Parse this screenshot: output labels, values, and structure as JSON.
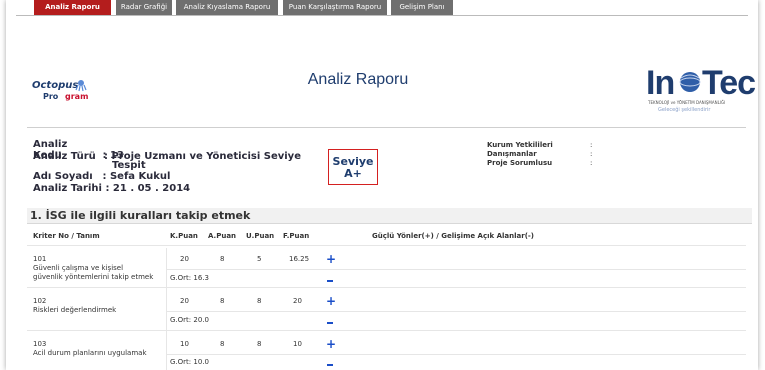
{
  "tabs": [
    {
      "label": "Analiz Raporu",
      "active": true
    },
    {
      "label": "Radar Grafiği",
      "active": false
    },
    {
      "label": "Analiz Kıyaslama Raporu",
      "active": false
    },
    {
      "label": "Puan Karşılaştırma Raporu",
      "active": false
    },
    {
      "label": "Gelişim Planı",
      "active": false
    }
  ],
  "logos": {
    "left_line1": "Octopus",
    "left_line2_a": "Pro",
    "left_line2_b": "gram",
    "right_in": "In",
    "right_tec": "Tec",
    "right_sub": "TEKNOLOJİ ve YÖNETİM DANIŞMANLIĞI",
    "right_slogan": "Geleceği şekillendirir"
  },
  "report": {
    "title": "Analiz Raporu",
    "kod_label": "Analiz Kodu",
    "kod_value": ": 13",
    "tur_label": "Analiz Türü",
    "tur_value_1": ": Proje Uzmanı ve Yöneticisi Seviye",
    "tur_value_2": "Tespit",
    "ad_label": "Adı Soyadı",
    "ad_value": ": Sefa Kukul",
    "tarih_label": "Analiz Tarihi",
    "tarih_value": ": 21 . 05 . 2014",
    "seviye_label": "Seviye",
    "seviye_value": "A+",
    "kurum_label": "Kurum Yetkilileri",
    "danisman_label": "Danışmanlar",
    "sorumlu_label": "Proje Sorumlusu",
    "colon": ":"
  },
  "section": {
    "title": "1. İSG ile ilgili kuralları takip etmek",
    "headers": {
      "kriter": "Kriter No / Tanım",
      "k": "K.Puan",
      "a": "A.Puan",
      "u": "U.Puan",
      "f": "F.Puan",
      "guclu": "Güçlü Yönler(+) / Gelişime Açık Alanlar(-)"
    },
    "rows": [
      {
        "no": "101",
        "desc1": "Güvenli çalışma ve kişisel",
        "desc2": "güvenlik yöntemlerini takip etmek",
        "k": "20",
        "a": "8",
        "u": "5",
        "f": "16.25",
        "gort": "G.Ort: 16.3"
      },
      {
        "no": "102",
        "desc1": "Riskleri değerlendirmek",
        "desc2": "",
        "k": "20",
        "a": "8",
        "u": "8",
        "f": "20",
        "gort": "G.Ort: 20.0"
      },
      {
        "no": "103",
        "desc1": "Acil durum planlarını uygulamak",
        "desc2": "",
        "k": "10",
        "a": "8",
        "u": "8",
        "f": "10",
        "gort": "G.Ort: 10.0"
      }
    ]
  },
  "symbols": {
    "plus": "+"
  }
}
